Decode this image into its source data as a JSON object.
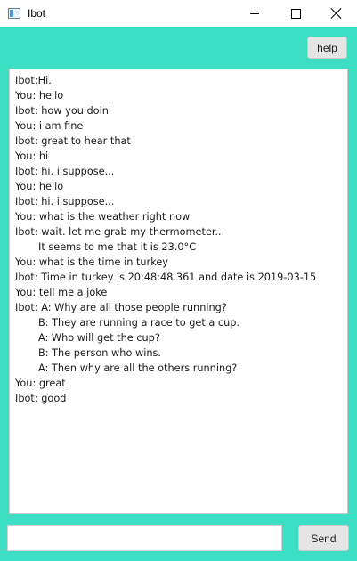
{
  "window": {
    "title": "Ibot",
    "icon": "app-window-icon",
    "controls": [
      "minimize-icon",
      "maximize-icon",
      "close-icon"
    ]
  },
  "toolbar": {
    "help_label": "help"
  },
  "chat": {
    "lines": [
      {
        "text": "Ibot:Hi.",
        "indent": false
      },
      {
        "text": "You: hello",
        "indent": false
      },
      {
        "text": "Ibot: how you doin'",
        "indent": false
      },
      {
        "text": "You: i am fine",
        "indent": false
      },
      {
        "text": "Ibot: great to hear that",
        "indent": false
      },
      {
        "text": "You: hi",
        "indent": false
      },
      {
        "text": "Ibot: hi. i suppose...",
        "indent": false
      },
      {
        "text": "You: hello",
        "indent": false
      },
      {
        "text": "Ibot: hi. i suppose...",
        "indent": false
      },
      {
        "text": "You: what is the weather right now",
        "indent": false
      },
      {
        "text": "Ibot: wait. let me grab my thermometer...",
        "indent": false
      },
      {
        "text": "It seems to me that it is 23.0°C",
        "indent": true
      },
      {
        "text": "You: what is the time in turkey",
        "indent": false
      },
      {
        "text": "Ibot: Time in turkey is 20:48:48.361 and date is 2019-03-15",
        "indent": false
      },
      {
        "text": "You: tell me a joke",
        "indent": false
      },
      {
        "text": "Ibot: A: Why are all those people running?",
        "indent": false
      },
      {
        "text": "B: They are running a race to get a cup.",
        "indent": true
      },
      {
        "text": "A: Who will get the cup?",
        "indent": true
      },
      {
        "text": "B: The person who wins.",
        "indent": true
      },
      {
        "text": "A: Then why are all the others running?",
        "indent": true
      },
      {
        "text": "You: great",
        "indent": false
      },
      {
        "text": "Ibot: good",
        "indent": false
      }
    ]
  },
  "input": {
    "value": "",
    "placeholder": ""
  },
  "send_label": "Send",
  "colors": {
    "background": "#3cdfc4",
    "panel": "#ffffff",
    "button": "#e5e5e5"
  }
}
